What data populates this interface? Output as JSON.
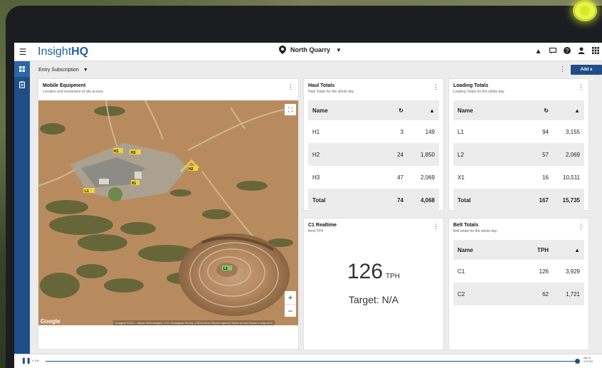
{
  "app": {
    "logo_light": "Insight",
    "logo_bold": "HQ",
    "site": "North Quarry"
  },
  "subheader": {
    "subscription": "Entry Subscription",
    "add_widget": "Add a widget"
  },
  "mobile_equipment": {
    "title": "Mobile Equipment",
    "subtitle": "Location and movement of site access",
    "map_attribution": "Imagery ©2021 , Maxar Technologies, U.S. Geological Survey, USDA Farm Service Agency   Terms of Use   Report a map error",
    "google": "Google",
    "zoom_in": "+",
    "zoom_out": "−",
    "markers": [
      "H1",
      "H2",
      "H3",
      "L1",
      "L2",
      "X1"
    ]
  },
  "haul_totals": {
    "title": "Haul Totals",
    "subtitle": "Haul Totals for the whole day",
    "col_name": "Name",
    "rows": [
      {
        "name": "H1",
        "a": "3",
        "b": "149"
      },
      {
        "name": "H2",
        "a": "24",
        "b": "1,850"
      },
      {
        "name": "H3",
        "a": "47",
        "b": "2,069"
      }
    ],
    "total": {
      "name": "Total",
      "a": "74",
      "b": "4,068"
    }
  },
  "loading_totals": {
    "title": "Loading Totals",
    "subtitle": "Loading Totals for the whole day",
    "col_name": "Name",
    "rows": [
      {
        "name": "L1",
        "a": "94",
        "b": "3,155"
      },
      {
        "name": "L2",
        "a": "57",
        "b": "2,069"
      },
      {
        "name": "X1",
        "a": "16",
        "b": "10,511"
      }
    ],
    "total": {
      "name": "Total",
      "a": "167",
      "b": "15,735"
    }
  },
  "c1_realtime": {
    "title": "C1 Realtime",
    "subtitle": "Best TPH",
    "value": "126",
    "unit": "TPH",
    "target": "Target: N/A"
  },
  "belt_totals": {
    "title": "Belt Totals",
    "subtitle": "Belt totals for the whole day",
    "col_name": "Name",
    "col_tph": "TPH",
    "rows": [
      {
        "name": "C1",
        "a": "126",
        "b": "3,929"
      },
      {
        "name": "C2",
        "a": "62",
        "b": "1,721"
      }
    ]
  },
  "playback": {
    "speed": "x 100",
    "date": "Mar 11",
    "time": "3:03 PM",
    "progress": 0.997
  },
  "icons": {
    "menu": "hamburger-icon",
    "pin": "map-pin-icon",
    "bell": "bell-icon",
    "chat": "chat-icon",
    "help": "help-icon",
    "user": "user-icon",
    "apps": "grid-icon",
    "dashboard": "dashboard-icon",
    "reports": "clipboard-icon",
    "refresh": "refresh-icon",
    "pile": "stockpile-icon"
  },
  "colors": {
    "brand": "#1f4f86",
    "led": "#d4ea2c"
  }
}
